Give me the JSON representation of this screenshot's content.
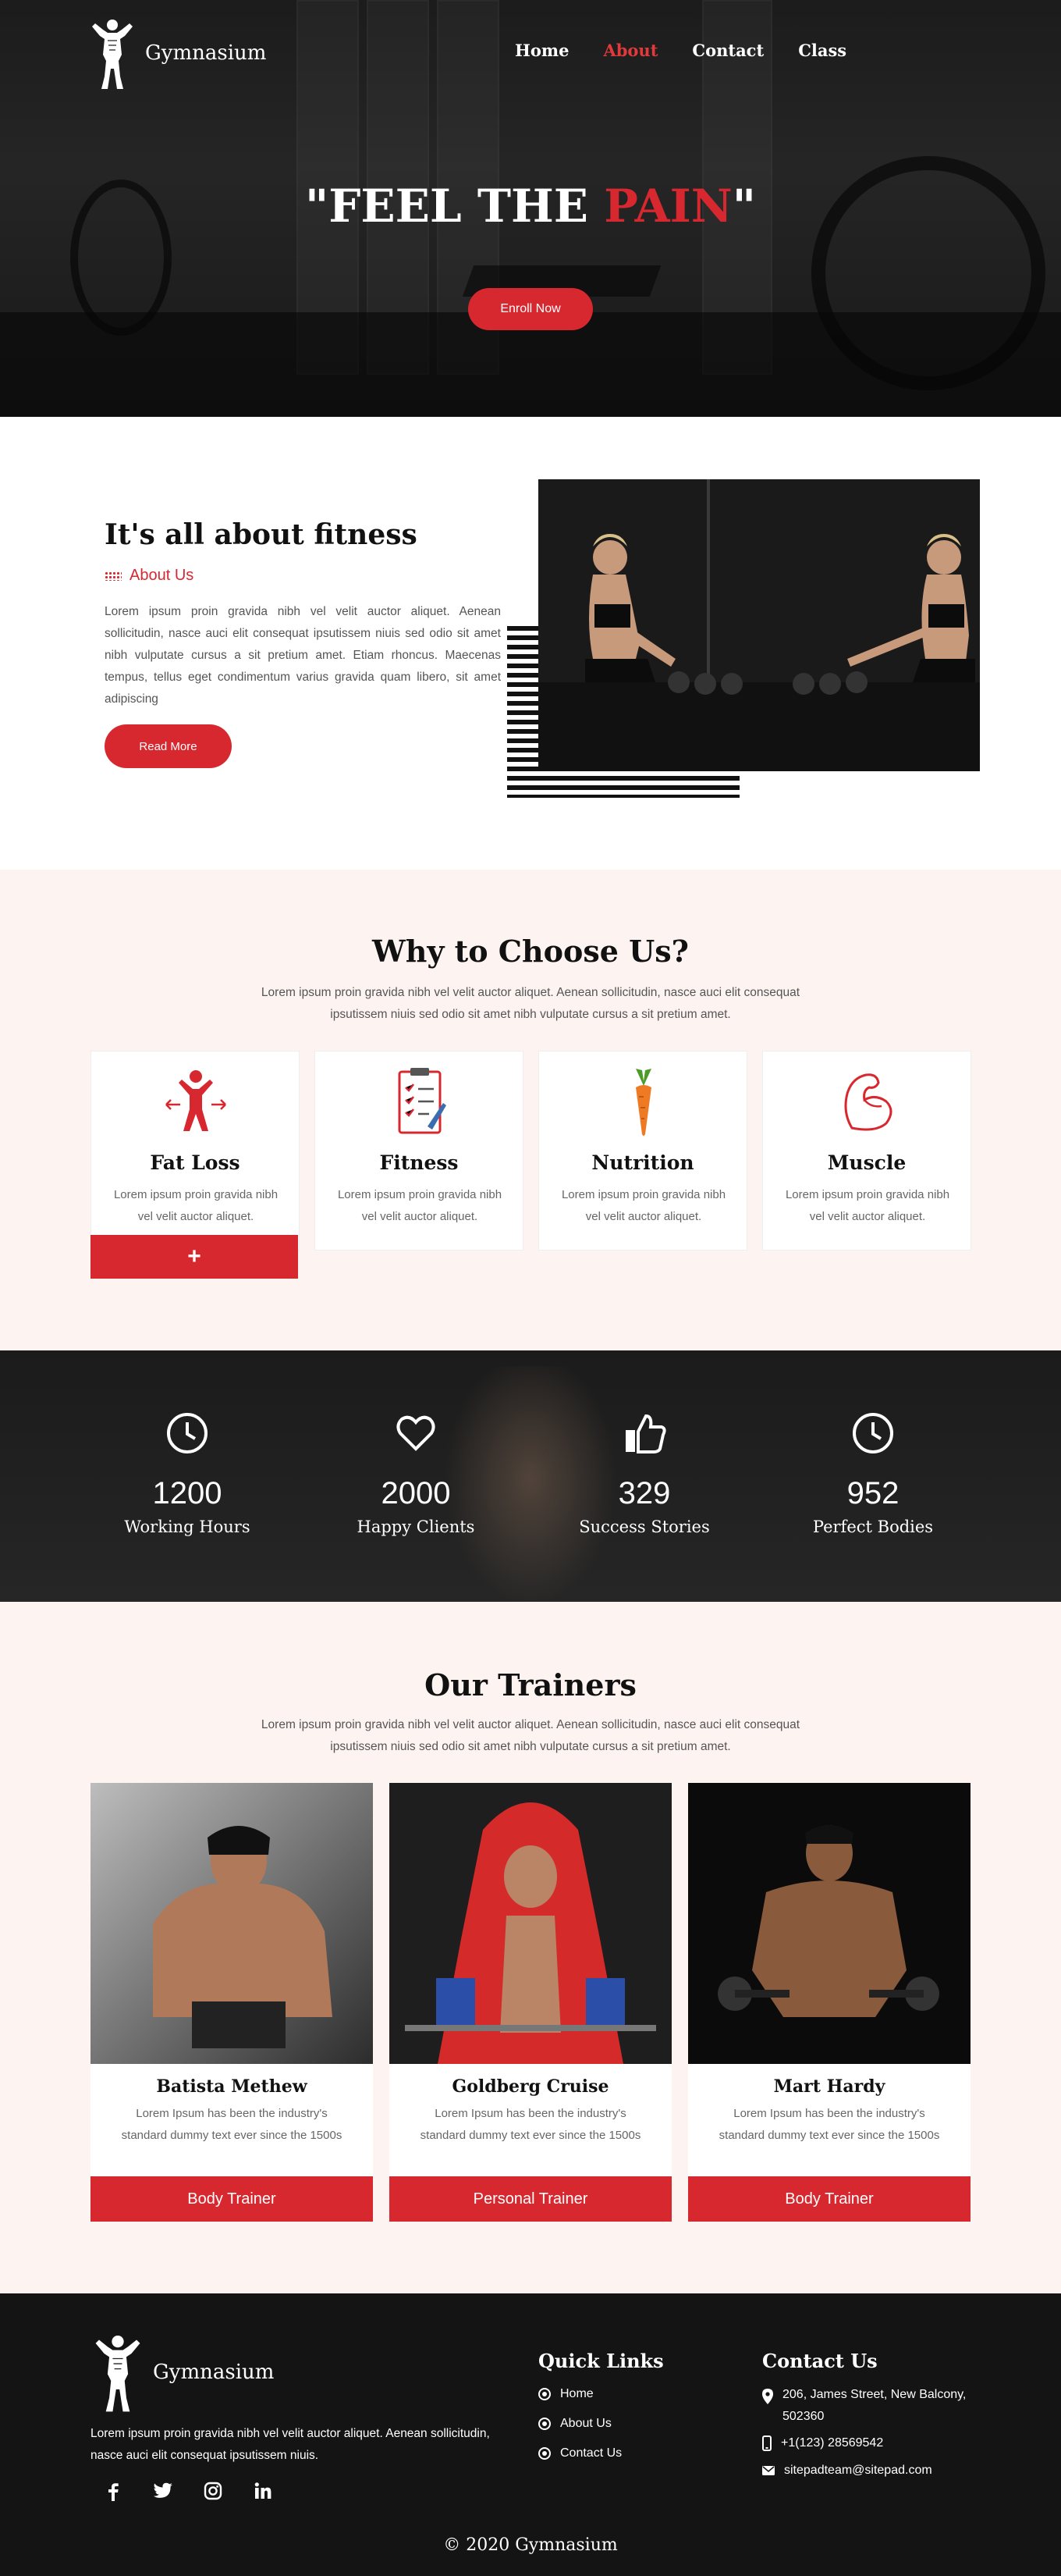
{
  "brand": {
    "name": "Gymnasium"
  },
  "nav": {
    "items": [
      "Home",
      "About",
      "Contact",
      "Class"
    ],
    "active": "About"
  },
  "hero": {
    "title_white": "\"FEEL THE ",
    "title_red": "PAIN",
    "title_end": "\"",
    "cta": "Enroll Now"
  },
  "about": {
    "title": "It's all about fitness",
    "subtitle": "About Us",
    "text": "Lorem ipsum proin gravida nibh vel velit auctor aliquet. Aenean sollicitudin, nasce auci elit consequat ipsutissem niuis sed odio sit amet nibh vulputate cursus a sit pretium amet. Etiam rhoncus. Maecenas tempus, tellus eget condimentum varius gravida quam libero, sit amet adipiscing",
    "button": "Read More"
  },
  "why": {
    "title": "Why to Choose Us?",
    "subtitle": "Lorem ipsum proin gravida nibh vel velit auctor aliquet. Aenean sollicitudin, nasce auci elit consequat ipsutissem niuis sed odio sit amet nibh vulputate cursus a sit pretium amet.",
    "cards": [
      {
        "title": "Fat Loss",
        "text": "Lorem ipsum proin gravida nibh vel velit auctor aliquet.",
        "icon": "fat-loss-icon"
      },
      {
        "title": "Fitness",
        "text": "Lorem ipsum proin gravida nibh vel velit auctor aliquet.",
        "icon": "clipboard-icon"
      },
      {
        "title": "Nutrition",
        "text": "Lorem ipsum proin gravida nibh vel velit auctor aliquet.",
        "icon": "carrot-icon"
      },
      {
        "title": "Muscle",
        "text": "Lorem ipsum proin gravida nibh vel velit auctor aliquet.",
        "icon": "muscle-icon"
      }
    ],
    "plus": "+"
  },
  "stats": [
    {
      "number": "1200",
      "label": "Working Hours",
      "icon": "clock-icon"
    },
    {
      "number": "2000",
      "label": "Happy Clients",
      "icon": "heart-icon"
    },
    {
      "number": "329",
      "label": "Success Stories",
      "icon": "thumbs-up-icon"
    },
    {
      "number": "952",
      "label": "Perfect Bodies",
      "icon": "clock-icon"
    }
  ],
  "trainers": {
    "title": "Our Trainers",
    "subtitle": "Lorem ipsum proin gravida nibh vel velit auctor aliquet. Aenean sollicitudin, nasce auci elit consequat ipsutissem niuis sed odio sit amet nibh vulputate cursus a sit pretium amet.",
    "list": [
      {
        "name": "Batista Methew",
        "text": "Lorem Ipsum has been the industry's standard dummy text ever since the 1500s",
        "role": "Body Trainer"
      },
      {
        "name": "Goldberg Cruise",
        "text": "Lorem Ipsum has been the industry's standard dummy text ever since the 1500s",
        "role": "Personal Trainer"
      },
      {
        "name": "Mart Hardy",
        "text": "Lorem Ipsum has been the industry's standard dummy text ever since the 1500s",
        "role": "Body Trainer"
      }
    ]
  },
  "footer": {
    "desc": "Lorem ipsum proin gravida nibh vel velit auctor aliquet. Aenean sollicitudin, nasce auci elit consequat ipsutissem niuis.",
    "quick_title": "Quick Links",
    "quick_links": [
      "Home",
      "About Us",
      "Contact Us"
    ],
    "contact_title": "Contact Us",
    "address": "206, James Street, New Balcony, 502360",
    "phone": "+1(123) 28569542",
    "email": "sitepadteam@sitepad.com",
    "copyright": "© 2020 Gymnasium",
    "social": [
      "facebook-icon",
      "twitter-icon",
      "instagram-icon",
      "linkedin-icon"
    ]
  },
  "colors": {
    "accent": "#d8282f",
    "dark": "#141414",
    "blush": "#fdf3f1"
  }
}
